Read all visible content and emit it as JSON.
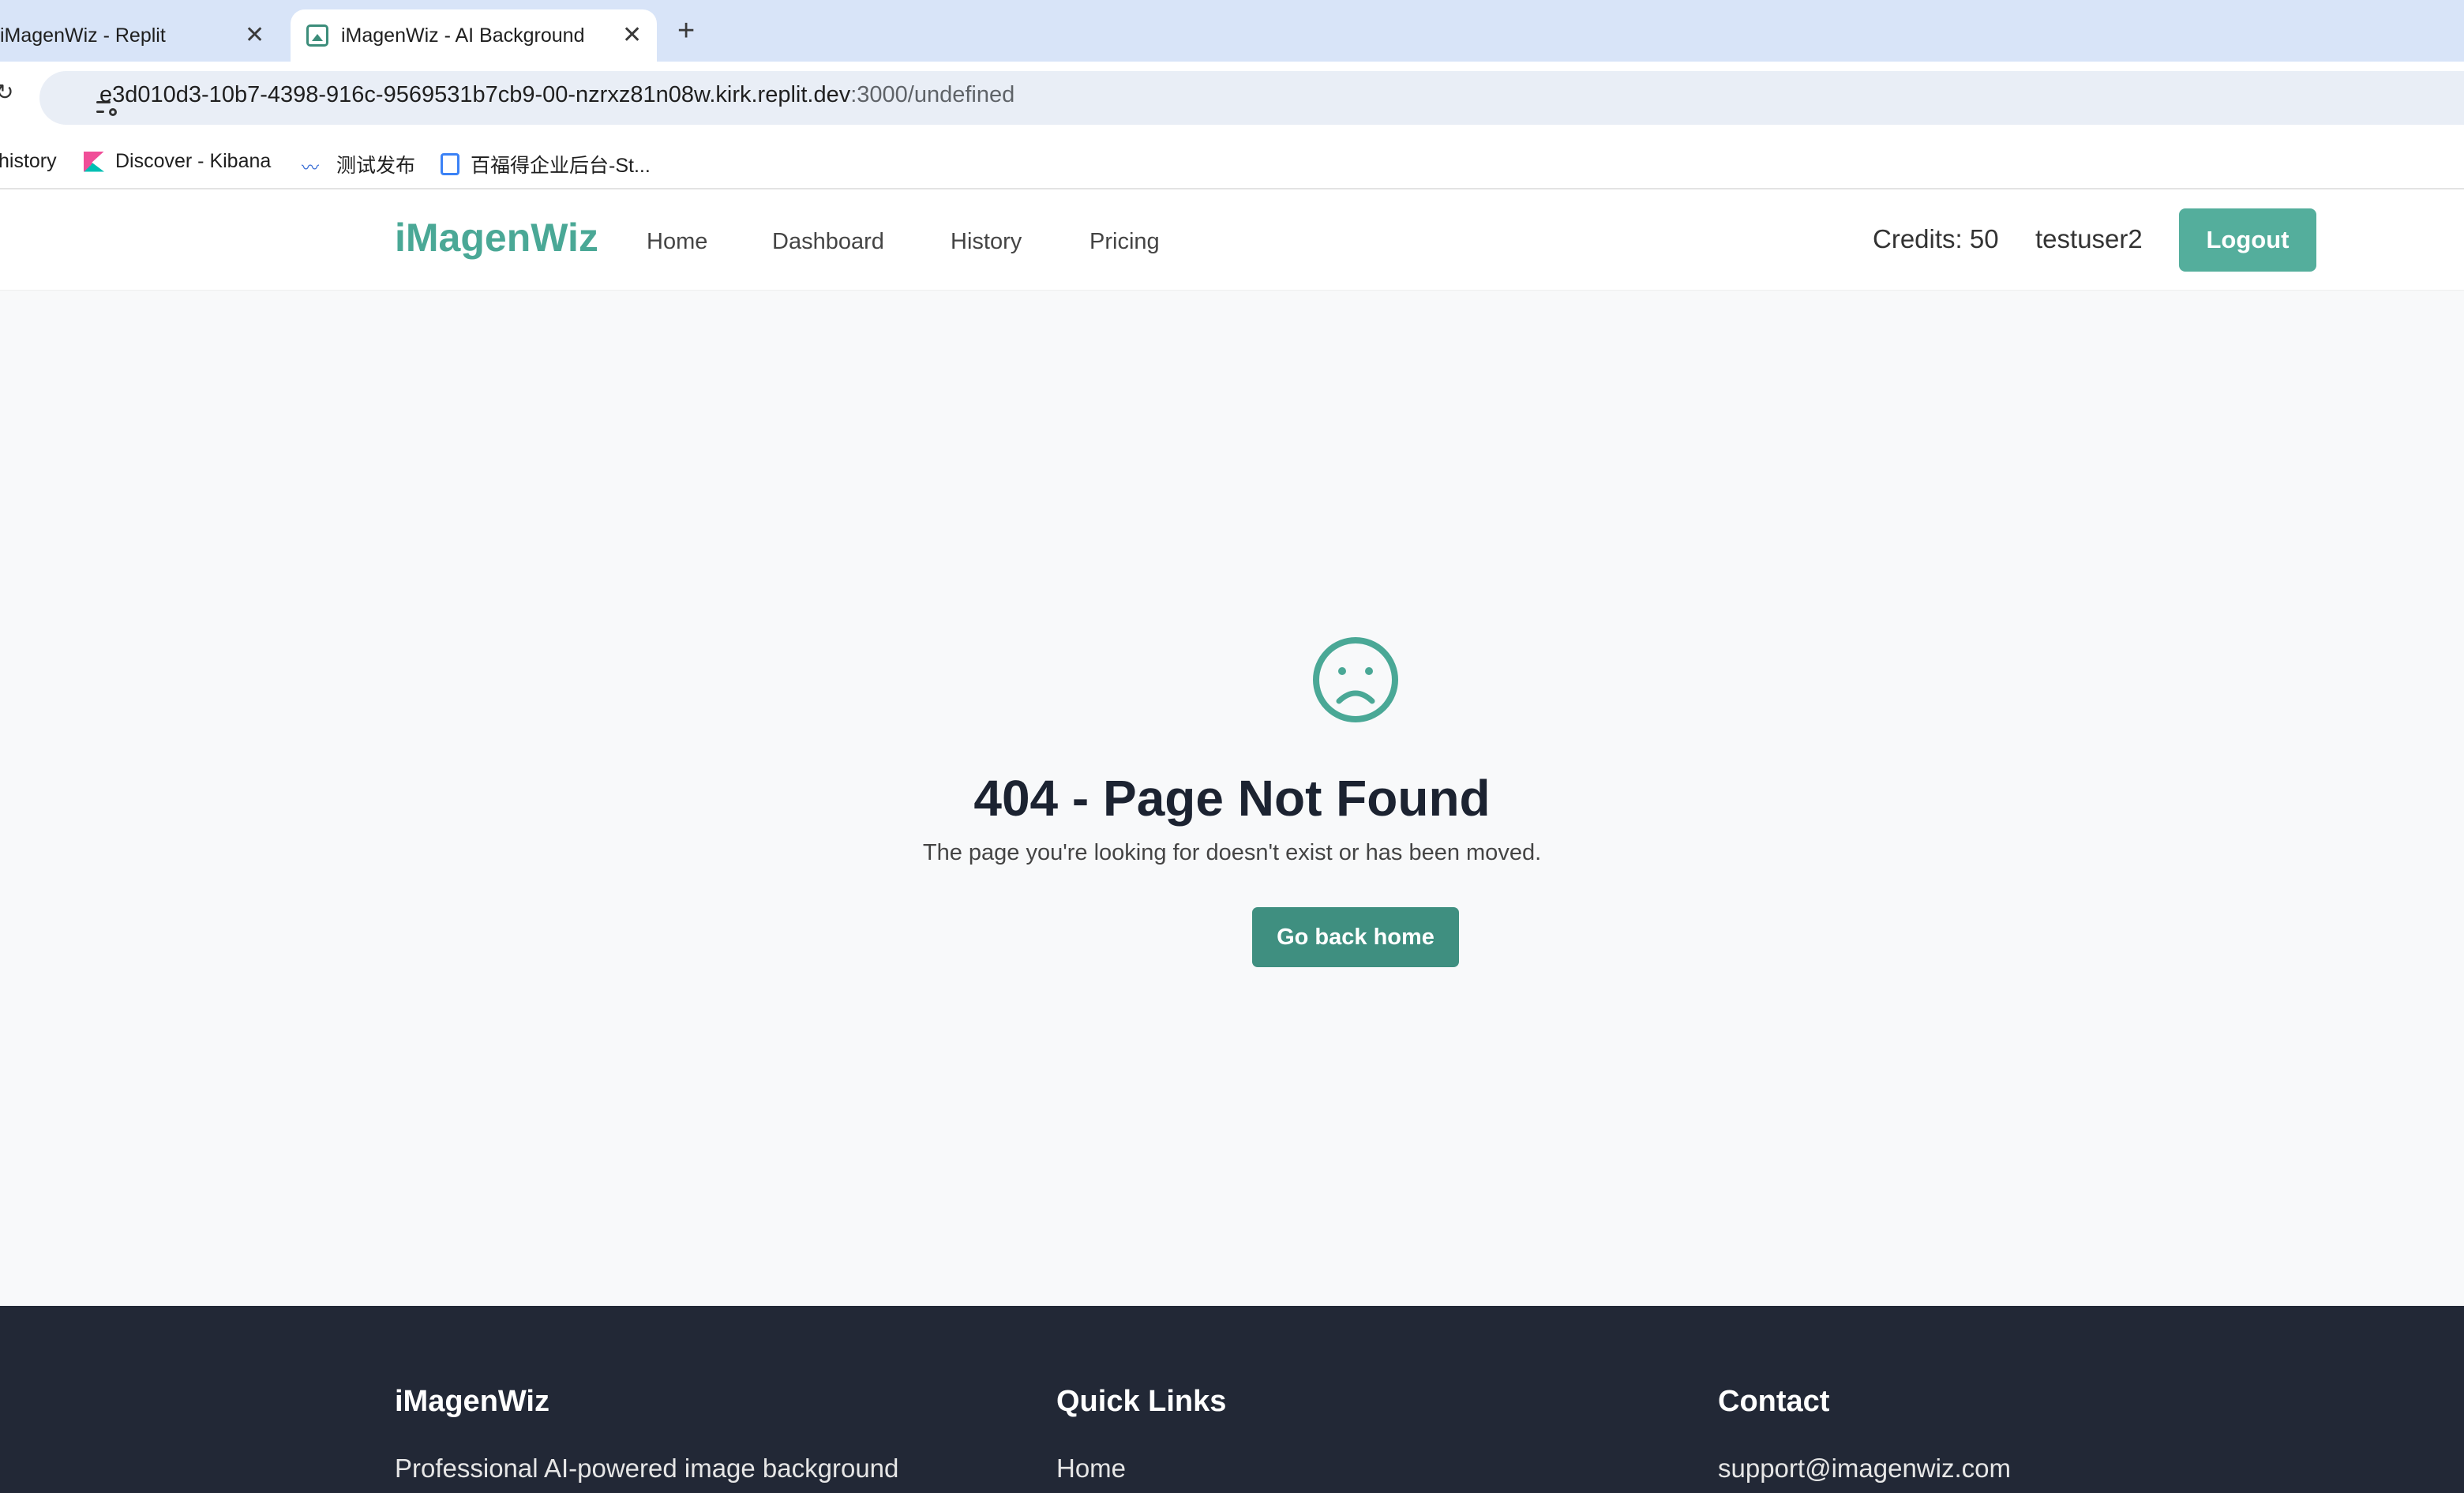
{
  "browser": {
    "tabs": [
      {
        "title": "iMagenWiz - Replit",
        "active": false
      },
      {
        "title": "iMagenWiz - AI Background Remover",
        "active": true
      }
    ],
    "new_tab_symbol": "+",
    "close_symbol": "✕",
    "url_host": "e3d010d3-10b7-4398-916c-9569531b7cb9-00-nzrxz81n08w.kirk.replit.dev",
    "url_path": ":3000/undefined",
    "bookmarks": [
      {
        "label": "history",
        "icon": "none"
      },
      {
        "label": "Discover - Kibana",
        "icon": "kibana-icon"
      },
      {
        "label": "测试发布",
        "icon": "wave-icon"
      },
      {
        "label": "百福得企业后台-St...",
        "icon": "bf-icon"
      }
    ]
  },
  "navbar": {
    "brand": "iMagenWiz",
    "links": [
      "Home",
      "Dashboard",
      "History",
      "Pricing"
    ],
    "credits": "Credits: 50",
    "username": "testuser2",
    "logout_label": "Logout"
  },
  "main": {
    "icon": "sad-face-icon",
    "title": "404 - Page Not Found",
    "description": "The page you're looking for doesn't exist or has been moved.",
    "button_label": "Go back home"
  },
  "footer": {
    "columns": [
      {
        "heading": "iMagenWiz",
        "text": "Professional AI-powered image background"
      },
      {
        "heading": "Quick Links",
        "text": "Home"
      },
      {
        "heading": "Contact",
        "text": "support@imagenwiz.com"
      }
    ]
  },
  "colors": {
    "accent": "#4aa896",
    "button": "#3f8f80",
    "footer_bg": "#222836",
    "tabbar_bg": "#d8e4f8"
  }
}
